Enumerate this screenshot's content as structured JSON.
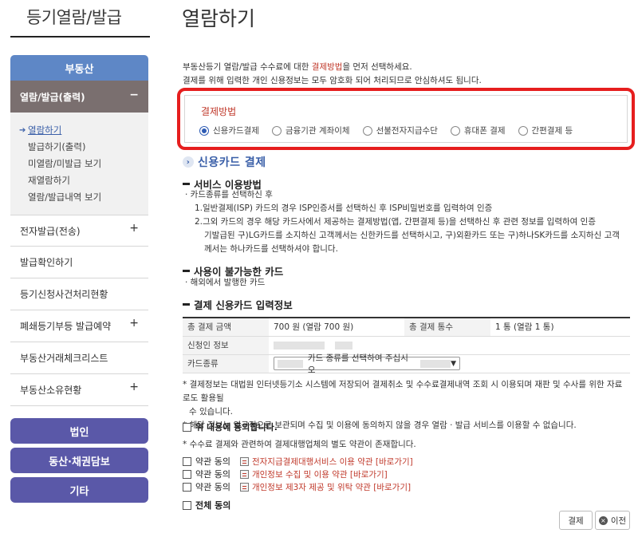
{
  "sidebar": {
    "title": "등기열람/발급",
    "category_realestate": "부동산",
    "active_menu": "열람/발급(출력)",
    "active_toggle": "−",
    "sub_items": [
      "열람하기",
      "발급하기(출력)",
      "미열람/미발급 보기",
      "재열람하기",
      "열람/발급내역 보기"
    ],
    "menu_items": [
      {
        "label": "전자발급(전송)",
        "toggle": "+"
      },
      {
        "label": "발급확인하기",
        "toggle": ""
      },
      {
        "label": "등기신청사건처리현황",
        "toggle": ""
      },
      {
        "label": "폐쇄등기부등 발급예약",
        "toggle": "+"
      },
      {
        "label": "부동산거래체크리스트",
        "toggle": ""
      },
      {
        "label": "부동산소유현황",
        "toggle": "+"
      }
    ],
    "category_corp": "법인",
    "category_movable": "동산·채권담보",
    "category_etc": "기타"
  },
  "main": {
    "title": "열람하기",
    "intro_line1_pre": "부동산등기 열람/발급 수수료에 대한 ",
    "intro_line1_red": "결제방법",
    "intro_line1_post": "을 먼저 선택하세요.",
    "intro_line2": "결제를 위해 입력한 개인 신용정보는 모두 암호화 되어 처리되므로 안심하셔도 됩니다."
  },
  "payment": {
    "title": "결제방법",
    "options": [
      {
        "label": "신용카드결제",
        "checked": true
      },
      {
        "label": "금융기관 계좌이체",
        "checked": false
      },
      {
        "label": "선불전자지급수단",
        "checked": false
      },
      {
        "label": "휴대폰 결제",
        "checked": false
      },
      {
        "label": "간편결제 등",
        "checked": false
      }
    ]
  },
  "credit": {
    "section_title": "신용카드 결제",
    "service_heading": "서비스 이용방법",
    "service_intro": "· 카드종류를 선택하신 후",
    "service_1": "1.일반결제(ISP) 카드의 경우 ISP인증서를 선택하신 후 ISP비밀번호를 입력하여 인증",
    "service_2a": "2.그외 카드의 경우 해당 카드사에서 제공하는 결제방법(앱, 간편결제 등)을 선택하신 후 관련 정보를 입력하여 인증",
    "service_2b": "기발급된 구)LG카드를 소지하신 고객께서는 신한카드를 선택하시고, 구)외환카드 또는 구)하나SK카드를 소지하신 고객",
    "service_2c": "께서는 하나카드를 선택하셔야 합니다.",
    "unavailable_heading": "사용이 불가능한 카드",
    "unavailable_text": "· 해외에서 발행한 카드",
    "info_heading": "결제 신용카드 입력정보"
  },
  "table": {
    "total_amount_label": "총 결제 금액",
    "total_amount_value": "700 원 (열람 700 원)",
    "total_count_label": "총 결제 통수",
    "total_count_value": "1 통 (열람 1 통)",
    "applicant_label": "신청인 정보",
    "card_type_label": "카드종류",
    "card_type_placeholder": "카드 종류를 선택하여 주십시오"
  },
  "notes": {
    "note1a": "* 결제정보는 대법원 인터넷등기소 시스템에 저장되어 결제취소 및 수수료결제내역 조회 시 이용되며 재판 및 수사를 위한 자료로도 활용될",
    "note1b": "수 있습니다.",
    "note2": "* 해당 정보는 영구적으로 보관되며 수집 및 이용에 동의하지 않을 경우 열람 · 발급 서비스를 이용할 수 없습니다.",
    "agree_label": "위 내용에 동의합니다.",
    "note3": "* 수수료 결제와 관련하여 결제대행업체의 별도 약관이 존재합니다.",
    "terms_agree": "약관 동의",
    "terms": [
      "전자지급결제대행서비스 이용 약관 [바로가기]",
      "개인정보 수집 및 이용 약관 [바로가기]",
      "개인정보 제3자 제공 및 위탁 약관 [바로가기]"
    ],
    "all_agree": "전체 동의"
  },
  "buttons": {
    "pay": "결제",
    "prev": "이전",
    "prev_icon": "×"
  }
}
